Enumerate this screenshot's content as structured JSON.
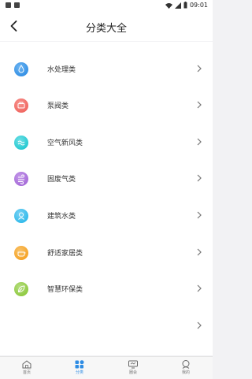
{
  "status_bar": {
    "time": "09:01"
  },
  "header": {
    "title": "分类大全"
  },
  "categories": [
    {
      "label": "水处理类",
      "color": "#2f8de4",
      "icon": "water-drop-icon"
    },
    {
      "label": "泵阀类",
      "color": "#f0635d",
      "icon": "pump-valve-icon"
    },
    {
      "label": "空气新风类",
      "color": "#1fc7cf",
      "icon": "air-fresh-icon"
    },
    {
      "label": "固废气类",
      "color": "#a468d8",
      "icon": "waste-gas-icon"
    },
    {
      "label": "建筑水类",
      "color": "#2bb8ea",
      "icon": "building-water-icon"
    },
    {
      "label": "舒适家居类",
      "color": "#f5a020",
      "icon": "comfort-home-icon"
    },
    {
      "label": "智慧环保类",
      "color": "#8cc83c",
      "icon": "smart-eco-icon"
    },
    {
      "label": "",
      "color": "",
      "icon": ""
    }
  ],
  "tabbar": {
    "tabs": [
      {
        "label": "首页",
        "icon": "home-icon"
      },
      {
        "label": "分类",
        "icon": "category-icon"
      },
      {
        "label": "圈会",
        "icon": "circle-icon"
      },
      {
        "label": "我的",
        "icon": "profile-icon"
      }
    ],
    "active_index": 1,
    "accent": "#2f8de4"
  }
}
